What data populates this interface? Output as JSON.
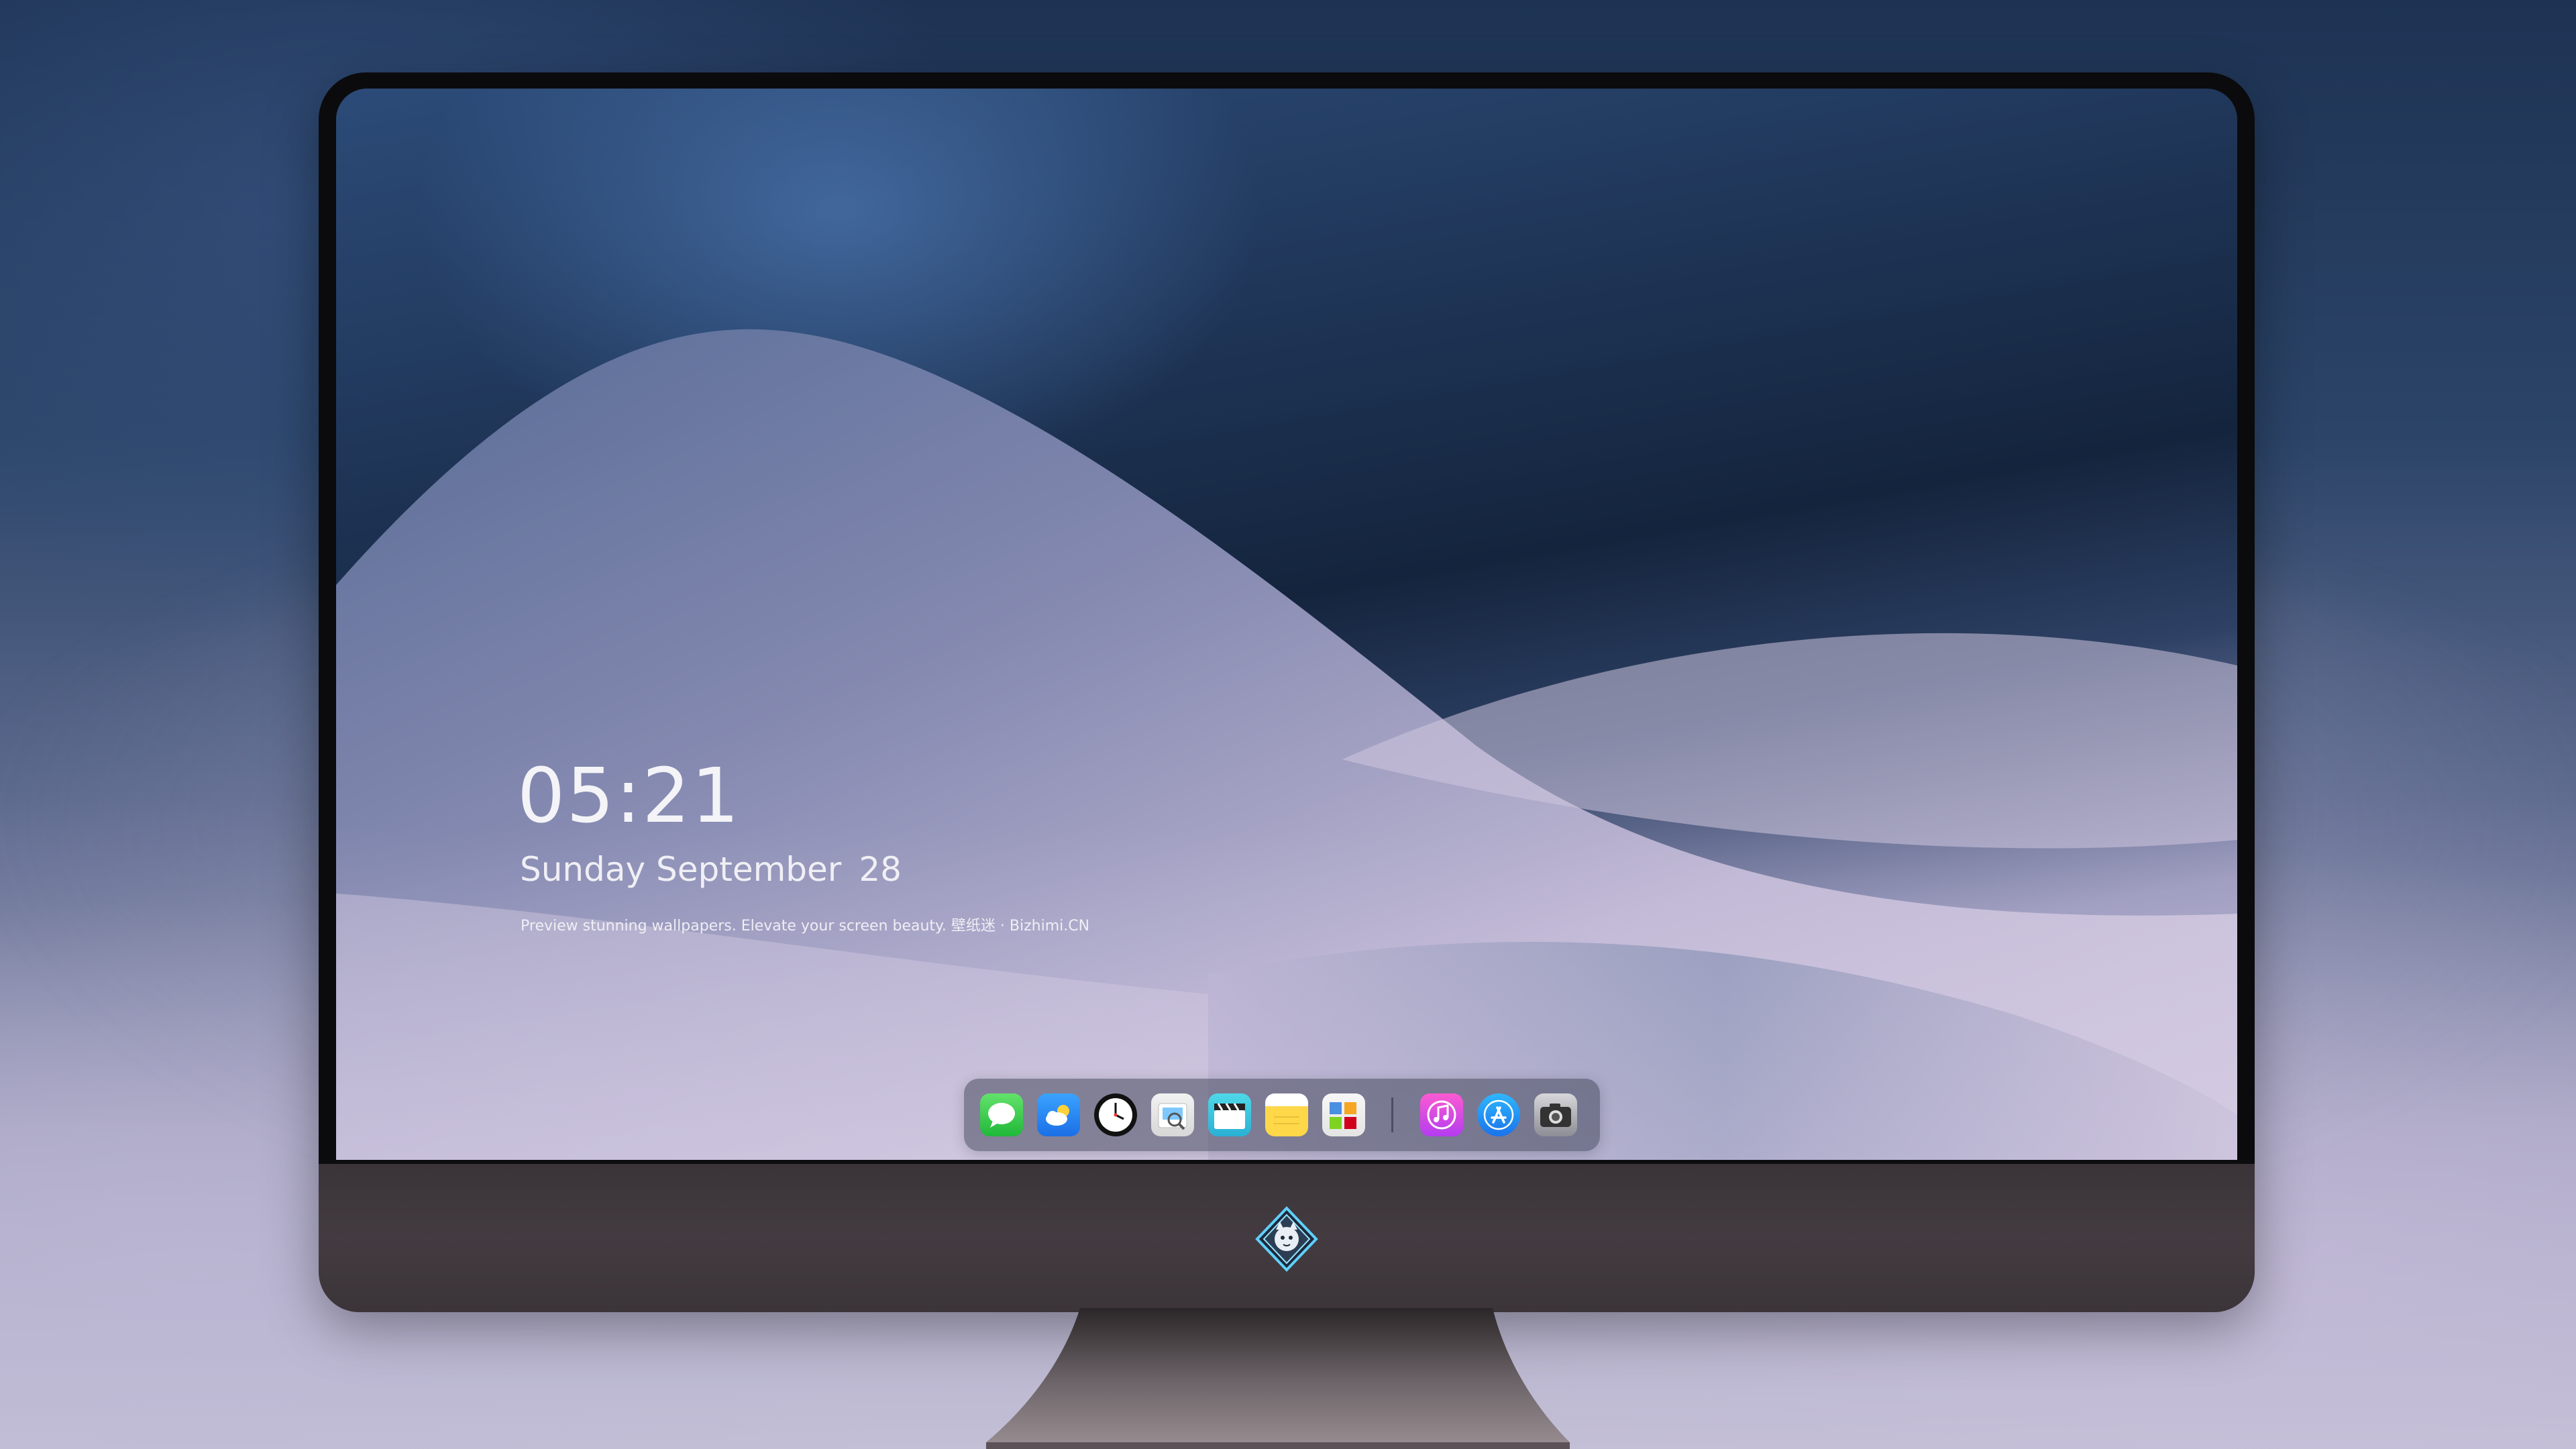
{
  "lock_screen": {
    "time": "05:21",
    "date_weekday_month": "Sunday September",
    "date_day": "28",
    "tagline": "Preview stunning wallpapers. Elevate your screen beauty. 壁纸迷 · Bizhimi.CN"
  },
  "dock": {
    "apps": [
      {
        "name": "messages",
        "icon": "speech-bubble-icon",
        "color": "#2fc34a"
      },
      {
        "name": "weather",
        "icon": "cloud-sun-icon",
        "color": "#2a8cf5"
      },
      {
        "name": "clock",
        "icon": "clock-face-icon",
        "color": "#111111"
      },
      {
        "name": "preview",
        "icon": "preview-viewer-icon",
        "color": "#e5e5e5"
      },
      {
        "name": "clips",
        "icon": "clapperboard-icon",
        "color": "#3ac4de"
      },
      {
        "name": "notes",
        "icon": "notepad-icon",
        "color": "#ffd84a"
      },
      {
        "name": "photos",
        "icon": "photo-grid-icon",
        "color": "#eeeeee"
      },
      {
        "name": "music",
        "icon": "music-note-icon",
        "color": "#e24de0"
      },
      {
        "name": "app-store",
        "icon": "app-store-a-icon",
        "color": "#1f8ef1"
      },
      {
        "name": "camera",
        "icon": "camera-icon",
        "color": "#a9a9b0"
      }
    ]
  },
  "bezel": {
    "logo_icon": "fox-emblem-logo"
  },
  "colors": {
    "monitor_frame": "#0b0b0d",
    "bezel": "#3f373c",
    "text": "#f4f4f8"
  }
}
